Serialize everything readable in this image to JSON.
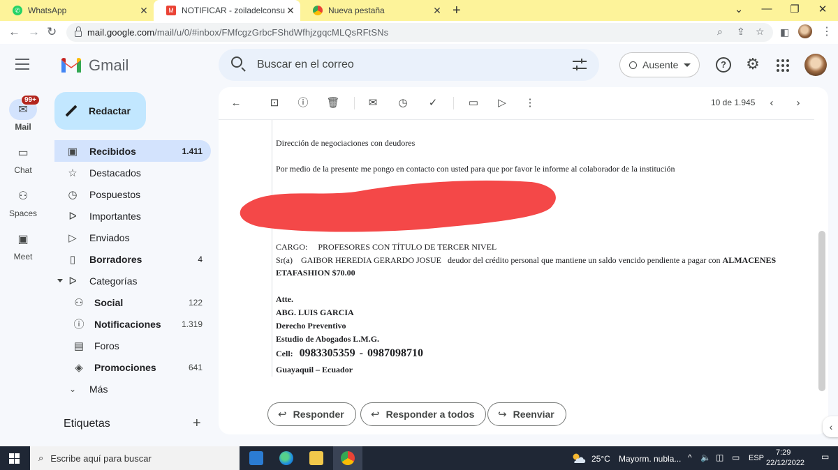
{
  "browser": {
    "tabs": [
      {
        "title": "WhatsApp",
        "favicon": "whatsapp-icon",
        "active": false
      },
      {
        "title": "NOTIFICAR - zoiladelconsuelo@g",
        "favicon": "gmail-icon",
        "active": true
      },
      {
        "title": "Nueva pestaña",
        "favicon": "chrome-icon",
        "active": false
      }
    ],
    "url_host": "mail.google.com",
    "url_path": "/mail/u/0/#inbox/FMfcgzGrbcFShdWfhjzgqcMLQsRFtSNs"
  },
  "gmail": {
    "brand": "Gmail",
    "search_placeholder": "Buscar en el correo",
    "status_label": "Ausente",
    "compose_label": "Redactar"
  },
  "rail": [
    {
      "label": "Mail",
      "icon": "mail-icon",
      "badge": "99+",
      "active": true
    },
    {
      "label": "Chat",
      "icon": "chat-icon",
      "active": false
    },
    {
      "label": "Spaces",
      "icon": "spaces-icon",
      "active": false
    },
    {
      "label": "Meet",
      "icon": "meet-icon",
      "active": false
    }
  ],
  "nav": [
    {
      "label": "Recibidos",
      "count": "1.411",
      "icon": "inbox-icon",
      "bold": true,
      "active": true
    },
    {
      "label": "Destacados",
      "count": "",
      "icon": "star-icon"
    },
    {
      "label": "Pospuestos",
      "count": "",
      "icon": "clock-icon"
    },
    {
      "label": "Importantes",
      "count": "",
      "icon": "important-icon"
    },
    {
      "label": "Enviados",
      "count": "",
      "icon": "send-icon"
    },
    {
      "label": "Borradores",
      "count": "4",
      "icon": "draft-icon",
      "bold": true
    },
    {
      "label": "Categorías",
      "count": "",
      "icon": "label-icon",
      "caret": true
    },
    {
      "label": "Social",
      "count": "122",
      "icon": "people-icon",
      "bold": true,
      "sub": true
    },
    {
      "label": "Notificaciones",
      "count": "1.319",
      "icon": "info-icon",
      "bold": true,
      "sub": true
    },
    {
      "label": "Foros",
      "count": "",
      "icon": "forum-icon",
      "sub": true
    },
    {
      "label": "Promociones",
      "count": "641",
      "icon": "tag-icon",
      "bold": true,
      "sub": true
    },
    {
      "label": "Más",
      "count": "",
      "icon": "chevron-down-icon"
    }
  ],
  "labels_heading": "Etiquetas",
  "message": {
    "pager": "10 de 1.945",
    "line_department": "Dirección de negociaciones con deudores",
    "line_intro": "Por medio de la presente me pongo en contacto con usted para que por favor le informe al colaborador de la institución",
    "line_cargo_label": "CARGO:",
    "line_cargo_value": "PROFESORES CON TÍTULO DE TERCER NIVEL",
    "line_sr_prefix": "Sr(a)",
    "line_sr_name": "GAIBOR HEREDIA GERARDO JOSUE",
    "line_sr_text": "deudor del crédito personal que mantiene un saldo vencido pendiente a pagar con",
    "line_store_1": "ALMACENES",
    "line_store_2": "ETAFASHION $70.00",
    "sig_atte": "Atte.",
    "sig_name": "ABG. LUIS GARCIA",
    "sig_area": "Derecho Preventivo",
    "sig_firm": "Estudio de Abogados L.M.G.",
    "sig_cell_label": "Cell:",
    "sig_cell_1": "0983305359",
    "sig_cell_sep": "-",
    "sig_cell_2": "0987098710",
    "sig_city": "Guayaquil – Ecuador"
  },
  "actions": {
    "reply": "Responder",
    "reply_all": "Responder a todos",
    "forward": "Reenviar"
  },
  "taskbar": {
    "search_placeholder": "Escribe aquí para buscar",
    "weather_temp": "25°C",
    "weather_desc": "Mayorm. nubla...",
    "lang": "ESP",
    "time": "7:29",
    "date": "22/12/2022"
  },
  "colors": {
    "tabstrip": "#fdf39a",
    "compose": "#c2e7ff",
    "active_nav": "#d3e3fd",
    "redaction": "#f44848",
    "taskbar": "#1f2735"
  }
}
